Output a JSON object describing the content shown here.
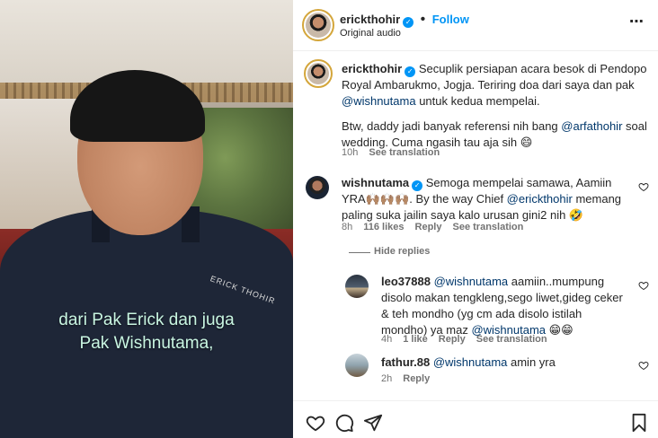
{
  "video": {
    "subtitle_line1": "dari Pak Erick dan juga",
    "subtitle_line2": "Pak Wishnutama,",
    "shirt_text": "ERICK THOHIR"
  },
  "header": {
    "username": "erickthohir",
    "follow_label": "Follow",
    "audio_label": "Original audio",
    "more_icon": "⋯"
  },
  "caption": {
    "username": "erickthohir",
    "text_part1": "Secuplik persiapan acara besok di Pendopo Royal Ambarukmo, Jogja. Teriring doa dari saya dan pak ",
    "mention1": "@wishnutama",
    "text_part2": " untuk kedua mempelai.",
    "text_part3": "Btw, daddy jadi banyak referensi nih bang ",
    "mention2": "@arfathohir",
    "text_part4": " soal wedding. Cuma ngasih tau aja sih 😄",
    "time": "10h",
    "see_translation": "See translation"
  },
  "comments": [
    {
      "username": "wishnutama",
      "text_part1": "Semoga mempelai samawa, Aamiin YRA🙌🏽🙌🏽🙌🏽. By the way Chief ",
      "mention": "@erickthohir",
      "text_part2": " memang paling suka jailin saya kalo urusan gini2 nih 🤣",
      "time": "8h",
      "likes": "116 likes",
      "reply": "Reply",
      "see_translation": "See translation"
    }
  ],
  "hide_replies": "Hide replies",
  "replies": [
    {
      "username": "leo37888",
      "mention1": "@wishnutama",
      "text_part1": " aamiin..mumpung disolo makan tengkleng,sego liwet,gideg ceker & teh mondho (yg cm ada disolo istilah mondho) ya maz ",
      "mention2": "@wishnutama",
      "text_part2": " 😁😁",
      "time": "4h",
      "likes": "1 like",
      "reply": "Reply",
      "see_translation": "See translation"
    },
    {
      "username": "fathur.88",
      "mention1": "@wishnutama",
      "text_part1": " amin yra",
      "time": "2h",
      "reply": "Reply"
    }
  ],
  "colors": {
    "accent": "#0095f6",
    "mention": "#00376b",
    "subtitle": "#c9f6e2"
  }
}
